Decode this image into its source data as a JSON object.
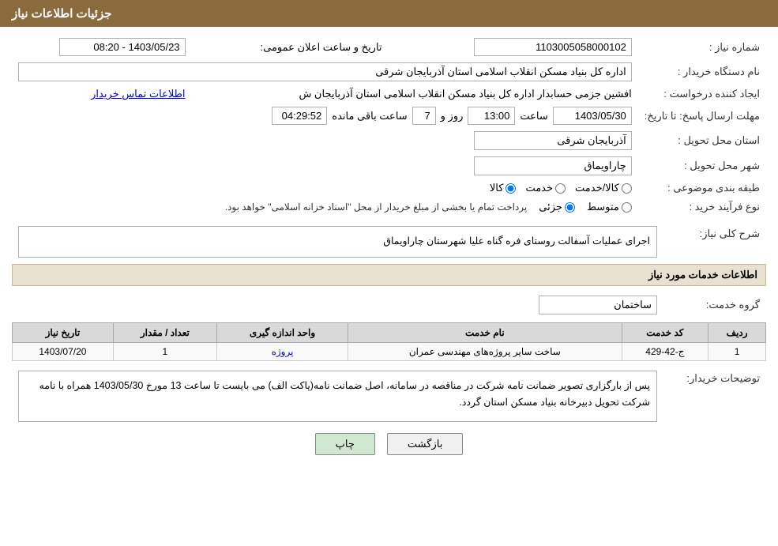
{
  "page": {
    "title": "جزئیات اطلاعات نیاز",
    "sections": {
      "details": "جزئیات اطلاعات نیاز",
      "services": "اطلاعات خدمات مورد نیاز"
    }
  },
  "fields": {
    "need_number_label": "شماره نیاز :",
    "need_number_value": "1103005058000102",
    "date_label": "تاریخ و ساعت اعلان عمومی:",
    "date_value": "1403/05/23 - 08:20",
    "buyer_label": "نام دستگاه خریدار :",
    "buyer_value": "اداره کل بنیاد مسکن انقلاب اسلامی استان آذربایجان شرقی",
    "creator_label": "ایجاد کننده درخواست :",
    "creator_value": "افشین جزمی حسابدار اداره کل بنیاد مسکن انقلاب اسلامی استان آذربایجان ش",
    "contact_link": "اطلاعات تماس خریدار",
    "deadline_label": "مهلت ارسال پاسخ: تا تاریخ:",
    "deadline_date": "1403/05/30",
    "deadline_time_label": "ساعت",
    "deadline_time": "13:00",
    "deadline_days_label": "روز و",
    "deadline_days": "7",
    "deadline_remaining_label": "ساعت باقی مانده",
    "deadline_remaining": "04:29:52",
    "province_label": "استان محل تحویل :",
    "province_value": "آذربایجان شرقی",
    "city_label": "شهر محل تحویل :",
    "city_value": "چاراویماق",
    "category_label": "طبقه بندی موضوعی :",
    "category_options": [
      "کالا",
      "خدمت",
      "کالا/خدمت"
    ],
    "category_selected": "کالا",
    "process_label": "نوع فرآیند خرید :",
    "process_options": [
      "جزئی",
      "متوسط"
    ],
    "process_note": "پرداخت تمام یا بخشی از مبلغ خریدار از محل \"اسناد خزانه اسلامی\" خواهد بود.",
    "description_label": "شرح کلی نیاز:",
    "description_value": "اجرای عملیات آسفالت روستای فره گناه علیا شهرستان چاراویماق",
    "service_group_label": "گروه خدمت:",
    "service_group_value": "ساختمان"
  },
  "services_table": {
    "columns": [
      "ردیف",
      "کد خدمت",
      "نام خدمت",
      "واحد اندازه گیری",
      "تعداد / مقدار",
      "تاریخ نیاز"
    ],
    "rows": [
      {
        "row": "1",
        "code": "ج-42-429",
        "name": "ساخت سایر پروژه‌های مهندسی عمران",
        "unit": "پروژه",
        "quantity": "1",
        "date": "1403/07/20"
      }
    ]
  },
  "notes": {
    "label": "توضیحات خریدار:",
    "text": "پس از بارگزاری تصویر ضمانت نامه شرکت در مناقصه در سامانه، اصل ضمانت نامه(پاکت الف) می بایست تا ساعت 13 مورخ 1403/05/30 همراه با نامه شرکت تحویل دبیرخانه بنیاد مسکن استان گردد."
  },
  "buttons": {
    "back": "بازگشت",
    "print": "چاپ"
  }
}
